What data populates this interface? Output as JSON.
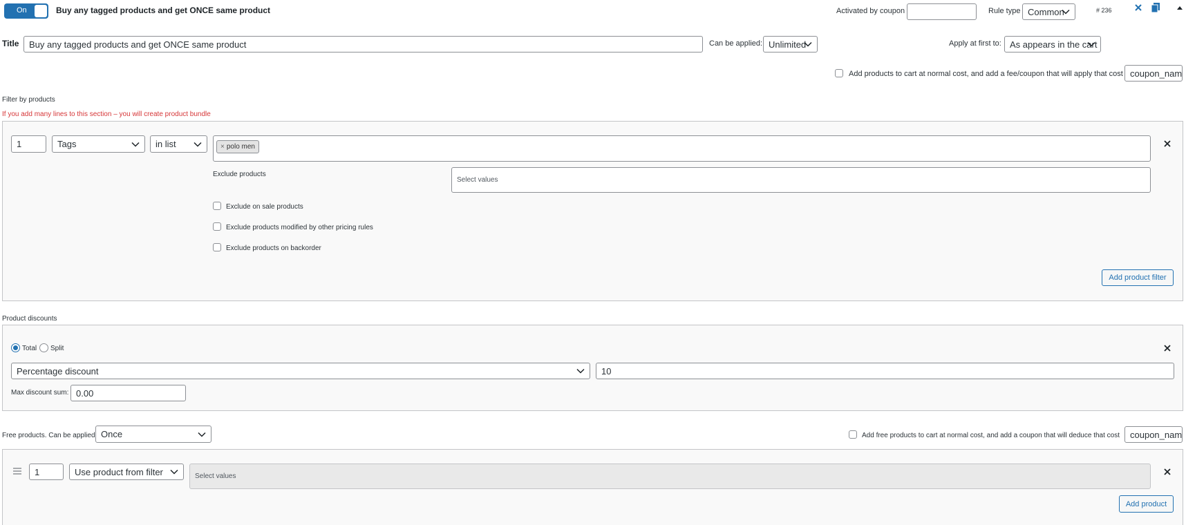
{
  "header": {
    "toggle_label": "On",
    "rule_title": "Buy any tagged products and get ONCE same product",
    "activated_by_coupon_label": "Activated by coupon",
    "activated_by_coupon_value": "",
    "rule_type_label": "Rule type",
    "rule_type_value": "Common",
    "rule_id": "# 236"
  },
  "title_row": {
    "title_label": "Title",
    "title_value": "Buy any tagged products and get ONCE same product",
    "can_be_applied_label": "Can be applied:",
    "can_be_applied_value": "Unlimited",
    "apply_first_label": "Apply at first to:",
    "apply_first_value": "As appears in the cart"
  },
  "fee_row": {
    "label": "Add products to cart at normal cost, and add a fee/coupon that will apply that cost",
    "coupon_value": "coupon_name"
  },
  "filter": {
    "section_label": "Filter by products",
    "warning": "If you add many lines to this section – you will create product bundle",
    "qty": "1",
    "type_value": "Tags",
    "method_value": "in list",
    "tags": [
      "polo men"
    ],
    "exclude_label": "Exclude products",
    "exclude_placeholder": "Select values",
    "checkboxes": [
      "Exclude on sale products",
      "Exclude products modified by other pricing rules",
      "Exclude products on backorder"
    ],
    "add_button": "Add product filter"
  },
  "discounts": {
    "section_label": "Product discounts",
    "total_label": "Total",
    "split_label": "Split",
    "selected": "Total",
    "type_value": "Percentage discount",
    "amount_value": "10",
    "max_label": "Max discount sum:",
    "max_value": "0.00"
  },
  "free": {
    "label": "Free products. Can be applied",
    "applied_value": "Once",
    "cost_label": "Add free products to cart at normal cost, and add a coupon that will deduce that cost",
    "coupon_value": "coupon_name",
    "qty": "1",
    "source_value": "Use product from filter",
    "values_placeholder": "Select values",
    "add_button": "Add product"
  },
  "colors": {
    "accent": "#2271b1",
    "warning": "#d63638",
    "border": "#8c8f94",
    "panel_bg": "#f9f9f9"
  }
}
